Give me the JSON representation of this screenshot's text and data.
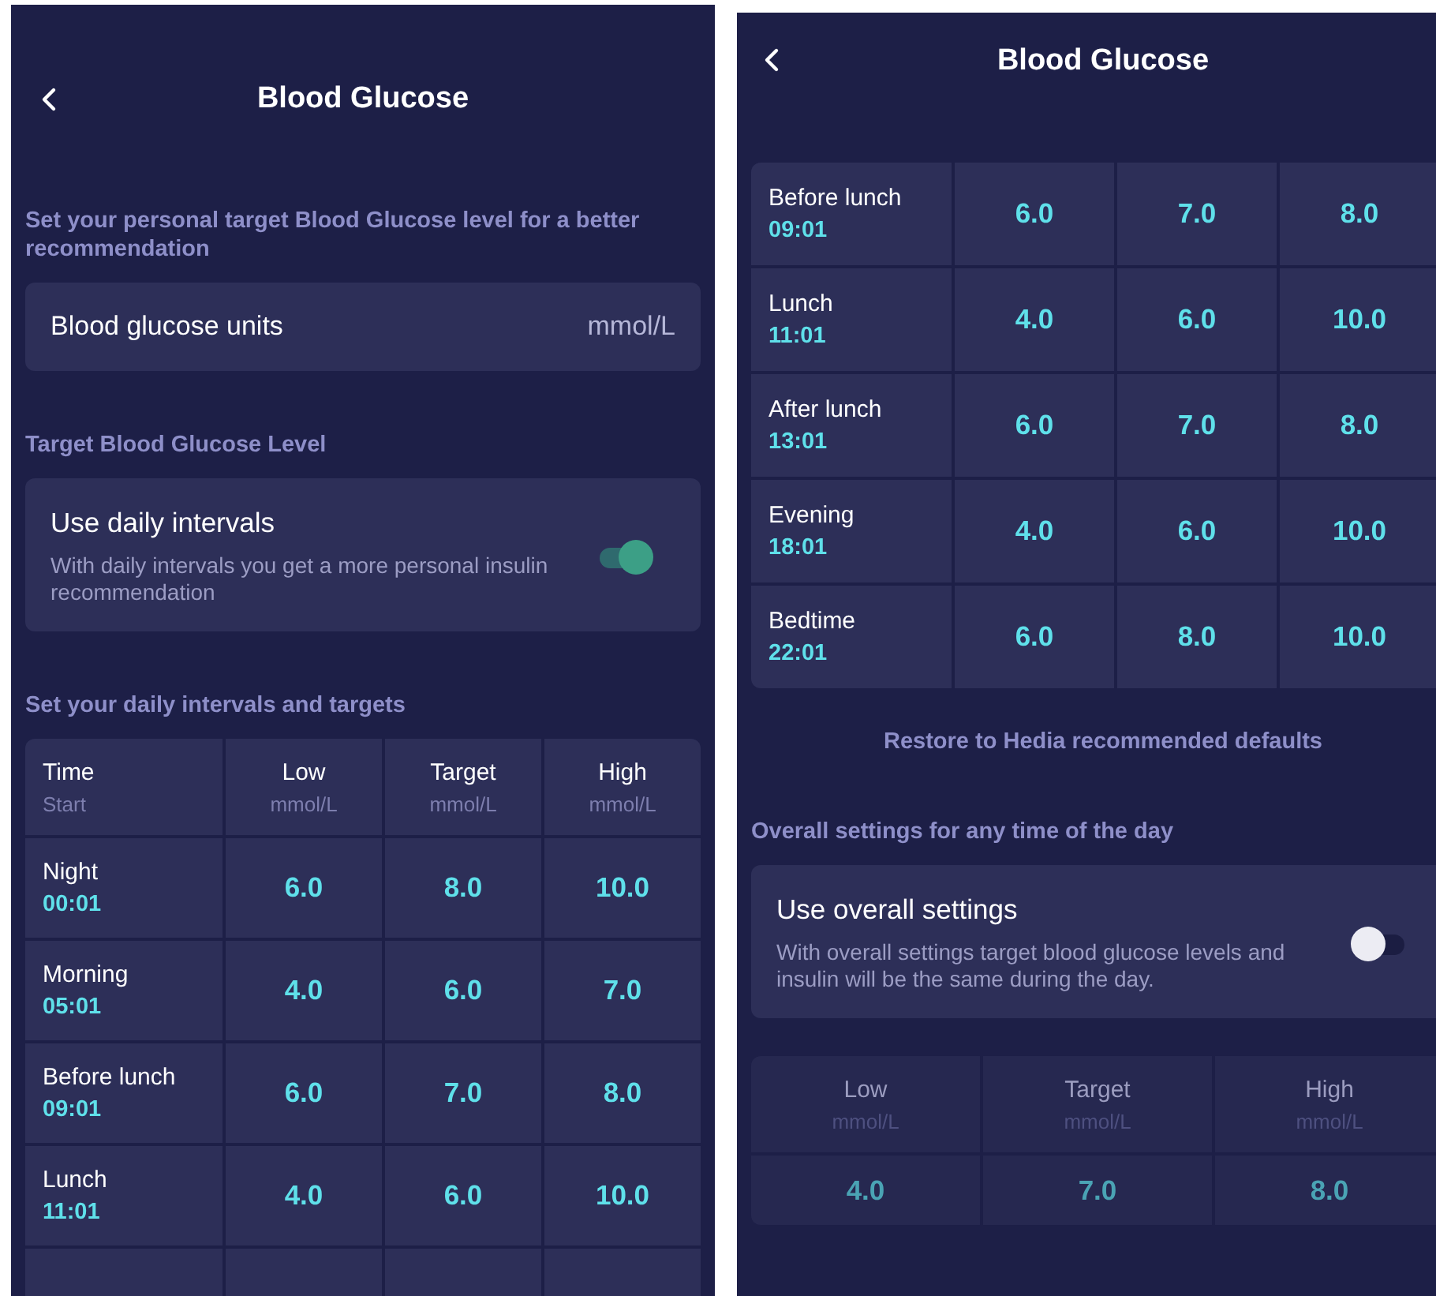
{
  "screens": [
    {
      "title": "Blood Glucose",
      "sections": [
        {
          "kind": "heading",
          "text": "Set your personal target Blood Glucose level for a better recommendation"
        },
        {
          "kind": "value_row",
          "label": "Blood glucose units",
          "value": "mmol/L"
        },
        {
          "kind": "heading",
          "text": "Target Blood Glucose Level"
        },
        {
          "kind": "toggle_card",
          "title": "Use daily intervals",
          "description": "With daily intervals you get a more personal insulin recommendation",
          "on": true
        },
        {
          "kind": "heading",
          "text": "Set your daily intervals and targets"
        },
        {
          "kind": "interval_table",
          "cut_row": true,
          "columns": [
            {
              "label": "Time",
              "unit": "Start"
            },
            {
              "label": "Low",
              "unit": "mmol/L"
            },
            {
              "label": "Target",
              "unit": "mmol/L"
            },
            {
              "label": "High",
              "unit": "mmol/L"
            }
          ],
          "rows": [
            {
              "name": "Night",
              "start": "00:01",
              "values": [
                "6.0",
                "8.0",
                "10.0"
              ]
            },
            {
              "name": "Morning",
              "start": "05:01",
              "values": [
                "4.0",
                "6.0",
                "7.0"
              ]
            },
            {
              "name": "Before lunch",
              "start": "09:01",
              "values": [
                "6.0",
                "7.0",
                "8.0"
              ]
            },
            {
              "name": "Lunch",
              "start": "11:01",
              "values": [
                "4.0",
                "6.0",
                "10.0"
              ]
            }
          ]
        }
      ]
    },
    {
      "title": "Blood Glucose",
      "sections": [
        {
          "kind": "interval_table",
          "rows": [
            {
              "name": "Before lunch",
              "start": "09:01",
              "values": [
                "6.0",
                "7.0",
                "8.0"
              ]
            },
            {
              "name": "Lunch",
              "start": "11:01",
              "values": [
                "4.0",
                "6.0",
                "10.0"
              ]
            },
            {
              "name": "After lunch",
              "start": "13:01",
              "values": [
                "6.0",
                "7.0",
                "8.0"
              ]
            },
            {
              "name": "Evening",
              "start": "18:01",
              "values": [
                "4.0",
                "6.0",
                "10.0"
              ]
            },
            {
              "name": "Bedtime",
              "start": "22:01",
              "values": [
                "6.0",
                "8.0",
                "10.0"
              ]
            }
          ]
        },
        {
          "kind": "link",
          "text": "Restore to Hedia recommended defaults"
        },
        {
          "kind": "heading",
          "text": "Overall settings for any time of the day"
        },
        {
          "kind": "toggle_card",
          "title": "Use overall settings",
          "description": "With overall settings target blood glucose levels and insulin will be the same during the day.",
          "on": false
        },
        {
          "kind": "values_table",
          "disabled": true,
          "columns": [
            {
              "label": "Low",
              "unit": "mmol/L"
            },
            {
              "label": "Target",
              "unit": "mmol/L"
            },
            {
              "label": "High",
              "unit": "mmol/L"
            }
          ],
          "values": [
            "4.0",
            "7.0",
            "8.0"
          ]
        }
      ]
    }
  ]
}
